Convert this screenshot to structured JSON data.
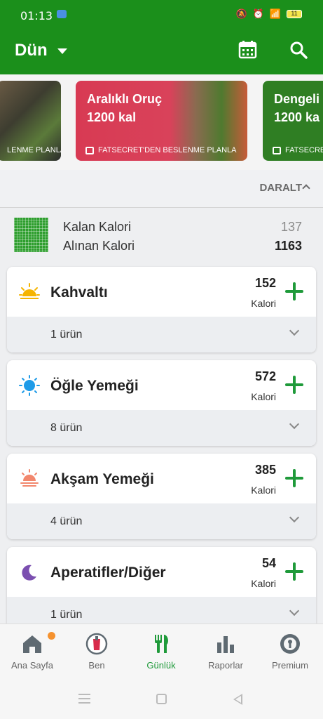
{
  "status_bar": {
    "time": "01:13",
    "battery": "11"
  },
  "header": {
    "title": "Dün",
    "calendar_icon": "calendar-icon",
    "search_icon": "search-icon"
  },
  "carousel": {
    "cards": [
      {
        "line1": "",
        "line2": "",
        "footer": "LENME PLANLA"
      },
      {
        "line1": "Aralıklı Oruç",
        "line2": "1200 kal",
        "footer": "FATSECRET'DEN BESLENME PLANLA"
      },
      {
        "line1": "Dengeli",
        "line2": "1200 ka",
        "footer": "FATSECRET"
      }
    ]
  },
  "collapse_label": "DARALT",
  "summary": {
    "remaining_label": "Kalan Kalori",
    "remaining_value": "137",
    "consumed_label": "Alınan Kalori",
    "consumed_value": "1163"
  },
  "meals": [
    {
      "name": "Kahvaltı",
      "calories": "152",
      "unit": "Kalori",
      "items": "1 ürün",
      "icon": "sunrise-icon"
    },
    {
      "name": "Öğle Yemeği",
      "calories": "572",
      "unit": "Kalori",
      "items": "8 ürün",
      "icon": "sun-icon"
    },
    {
      "name": "Akşam Yemeği",
      "calories": "385",
      "unit": "Kalori",
      "items": "4 ürün",
      "icon": "sunset-icon"
    },
    {
      "name": "Aperatifler/Diğer",
      "calories": "54",
      "unit": "Kalori",
      "items": "1 ürün",
      "icon": "moon-icon"
    }
  ],
  "bottom_nav": [
    {
      "label": "Ana Sayfa",
      "icon": "home-icon"
    },
    {
      "label": "Ben",
      "icon": "profile-icon"
    },
    {
      "label": "Günlük",
      "icon": "fork-knife-icon"
    },
    {
      "label": "Raporlar",
      "icon": "bar-chart-icon"
    },
    {
      "label": "Premium",
      "icon": "premium-icon"
    }
  ],
  "colors": {
    "primary_green": "#1b8f1b",
    "plus_green": "#1f9a3a",
    "badge_orange": "#f5922f"
  }
}
